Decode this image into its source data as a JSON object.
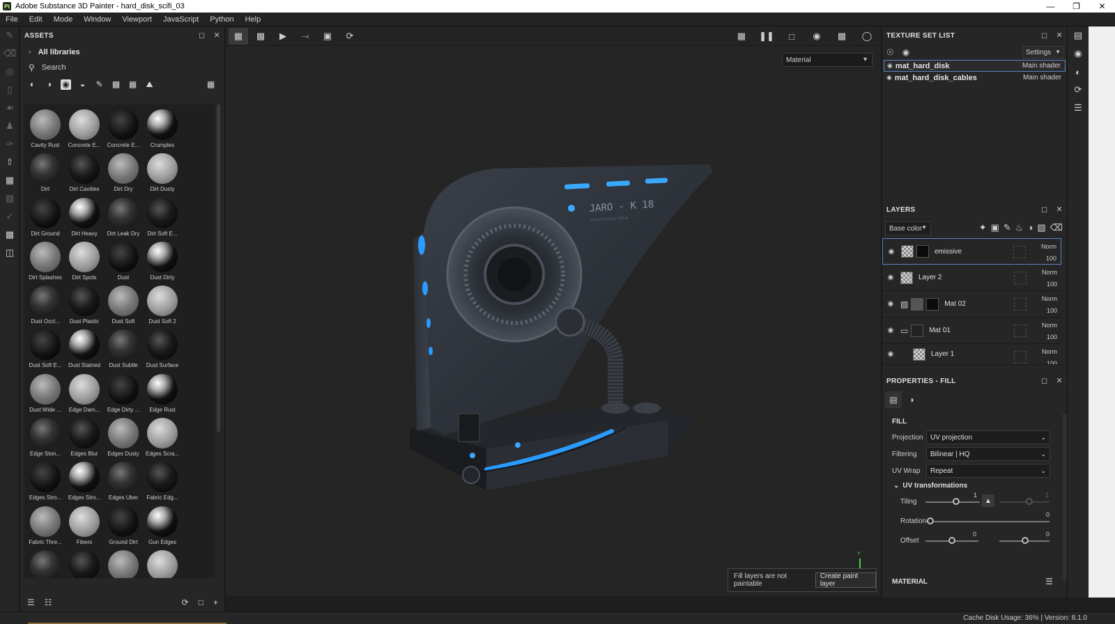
{
  "window": {
    "app_icon": "Pt",
    "title": "Adobe Substance 3D Painter - hard_disk_scifi_03",
    "controls": [
      "minimize-icon",
      "restore-icon",
      "close-icon"
    ]
  },
  "menu": [
    "File",
    "Edit",
    "Mode",
    "Window",
    "Viewport",
    "JavaScript",
    "Python",
    "Help"
  ],
  "assets": {
    "title": "ASSETS",
    "library": "All libraries",
    "search_placeholder": "Search",
    "items": [
      "Cavity Rust",
      "Concrete E...",
      "Concrete E...",
      "Crumples",
      "Dirt",
      "Dirt Cavities",
      "Dirt Dry",
      "Dirt Dusty",
      "Dirt Ground",
      "Dirt Heavy",
      "Dirt Leak Dry",
      "Dirt Soft E...",
      "Dirt Splashes",
      "Dirt Spots",
      "Dust",
      "Dust Dirty",
      "Dust Occl...",
      "Dust Plastic",
      "Dust Soft",
      "Dust Soft 2",
      "Dust Soft E...",
      "Dust Stained",
      "Dust Subtle",
      "Dust Surface",
      "Dust Wide ...",
      "Edge Dam...",
      "Edge Dirty ...",
      "Edge Rust",
      "Edge Ston...",
      "Edges Blur",
      "Edges Dusty",
      "Edges Scra...",
      "Edges Stro...",
      "Edges Stro...",
      "Edges Uber",
      "Fabric Edg...",
      "Fabric Thre...",
      "Fibers",
      "Ground Dirt",
      "Gun Edges",
      "",
      "",
      "",
      ""
    ]
  },
  "viewport": {
    "display_mode": "Material",
    "model_label": "JARO - K 18",
    "model_sublabel": "INFINITE HARD DRIVE",
    "notice": "Fill layers are not paintable",
    "create_button": "Create paint layer",
    "axis_label": "Y"
  },
  "texture_set_list": {
    "title": "TEXTURE SET LIST",
    "settings_label": "Settings",
    "sets": [
      {
        "name": "mat_hard_disk",
        "shader": "Main shader",
        "selected": true
      },
      {
        "name": "mat_hard_disk_cables",
        "shader": "Main shader",
        "selected": false
      }
    ]
  },
  "layers": {
    "title": "LAYERS",
    "channel": "Base color",
    "items": [
      {
        "name": "emissive",
        "blend": "Norm",
        "opacity": "100",
        "selected": true
      },
      {
        "name": "Layer 2",
        "blend": "Norm",
        "opacity": "100",
        "selected": false
      },
      {
        "name": "Mat 02",
        "blend": "Norm",
        "opacity": "100",
        "selected": false
      },
      {
        "name": "Mat 01",
        "blend": "Norm",
        "opacity": "100",
        "selected": false
      },
      {
        "name": "Layer 1",
        "blend": "Norm",
        "opacity": "100",
        "selected": false
      }
    ]
  },
  "properties": {
    "title": "PROPERTIES - FILL",
    "fill_section": "FILL",
    "projection_label": "Projection",
    "projection_value": "UV projection",
    "filtering_label": "Filtering",
    "filtering_value": "Bilinear | HQ",
    "uvwrap_label": "UV Wrap",
    "uvwrap_value": "Repeat",
    "uv_transformations": "UV transformations",
    "tiling_label": "Tiling",
    "tiling_value": "1",
    "tiling_value_2": "1",
    "rotation_label": "Rotation",
    "rotation_value": "0",
    "offset_label": "Offset",
    "offset_u": "0",
    "offset_v": "0",
    "material_section": "MATERIAL"
  },
  "status": {
    "cache_label": "Cache Disk Usage:",
    "cache_value": "36%",
    "version": "Version: 8.1.0"
  }
}
